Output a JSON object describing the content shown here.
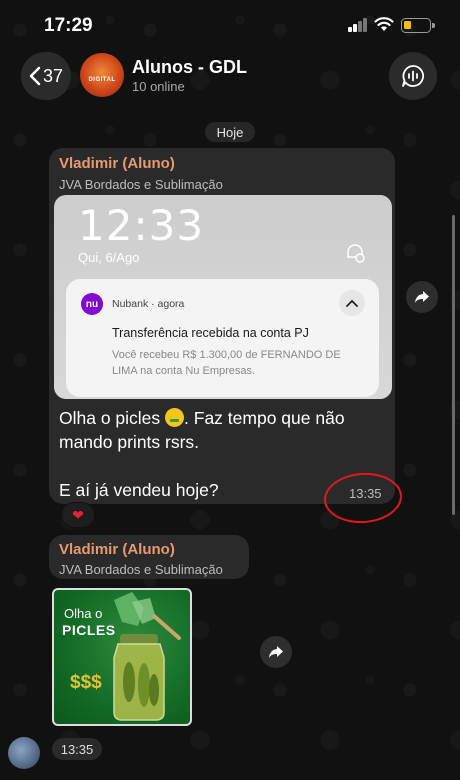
{
  "status_bar": {
    "time": "17:29"
  },
  "header": {
    "back_count": "37",
    "group_name": "Alunos - GDL",
    "online": "10 online",
    "avatar_text": "DIGITAL"
  },
  "date_separator": "Hoje",
  "message1": {
    "sender": "Vladimir (Aluno)",
    "sender_subtitle": "JVA Bordados e Sublimação",
    "screenshot": {
      "lock_time": "12:33",
      "lock_date": "Qui, 6/Ago",
      "notification": {
        "app_icon_text": "nu",
        "app": "Nubank · agora",
        "title": "Transferência recebida na conta PJ",
        "body": "Você recebeu R$ 1.300,00 de FERNANDO DE LIMA na conta Nu Empresas."
      }
    },
    "text_line1_a": "Olha o picles ",
    "text_line1_b": ". Faz tempo que não",
    "text_line2": "mando prints rsrs.",
    "text_line3": "E aí já vendeu hoje?",
    "time": "13:35",
    "reaction": "❤"
  },
  "message2": {
    "sender": "Vladimir (Aluno)",
    "sender_subtitle": "JVA Bordados e Sublimação",
    "sticker": {
      "line1": "Olha o",
      "line2": "PICLES",
      "money": "$$$"
    },
    "time": "13:35"
  },
  "colors": {
    "sender": "#e69a6f",
    "bubble": "#2a2a2a",
    "annotation_circle": "#e0181e",
    "nubank": "#820ad1"
  }
}
